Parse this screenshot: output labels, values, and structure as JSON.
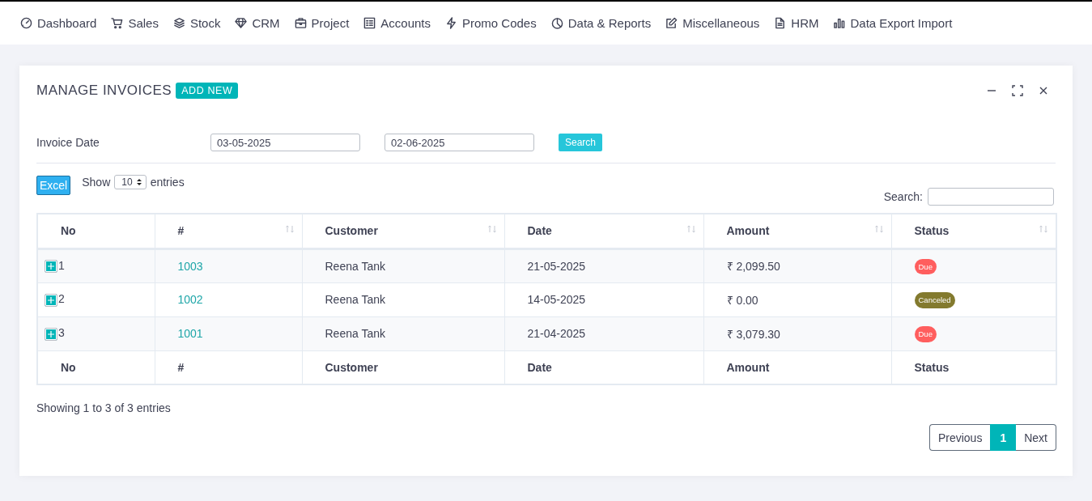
{
  "nav": [
    {
      "label": "Dashboard"
    },
    {
      "label": "Sales"
    },
    {
      "label": "Stock"
    },
    {
      "label": "CRM"
    },
    {
      "label": "Project"
    },
    {
      "label": "Accounts"
    },
    {
      "label": "Promo Codes"
    },
    {
      "label": "Data & Reports"
    },
    {
      "label": "Miscellaneous"
    },
    {
      "label": "HRM"
    },
    {
      "label": "Data Export Import"
    }
  ],
  "card": {
    "title": "MANAGE INVOICES",
    "add_button": "ADD NEW"
  },
  "filter": {
    "label": "Invoice Date",
    "from": "03-05-2025",
    "to": "02-06-2025",
    "button": "Search"
  },
  "toolbar": {
    "excel": "Excel",
    "show": "Show",
    "page_size": "10",
    "entries": "entries",
    "search_label": "Search:"
  },
  "table": {
    "columns": [
      {
        "label": "No",
        "sortable": false
      },
      {
        "label": "#",
        "sortable": true
      },
      {
        "label": "Customer",
        "sortable": true
      },
      {
        "label": "Date",
        "sortable": true
      },
      {
        "label": "Amount",
        "sortable": true
      },
      {
        "label": "Status",
        "sortable": true
      }
    ],
    "rows": [
      {
        "no": "1",
        "number": "1003",
        "customer": "Reena Tank",
        "date": "21-05-2025",
        "amount": "₹ 2,099.50",
        "status": "Due",
        "color": "#ff5e5e"
      },
      {
        "no": "2",
        "number": "1002",
        "customer": "Reena Tank",
        "date": "14-05-2025",
        "amount": "₹ 0.00",
        "status": "Canceled",
        "color": "#837a2e"
      },
      {
        "no": "3",
        "number": "1001",
        "customer": "Reena Tank",
        "date": "21-04-2025",
        "amount": "₹ 3,079.30",
        "status": "Due",
        "color": "#ff5e5e"
      }
    ],
    "footer": [
      "No",
      "#",
      "Customer",
      "Date",
      "Amount",
      "Status"
    ]
  },
  "info": "Showing 1 to 3 of 3 entries",
  "pagination": {
    "previous": "Previous",
    "pages": [
      {
        "label": "1",
        "selected": true
      }
    ],
    "next": "Next"
  }
}
